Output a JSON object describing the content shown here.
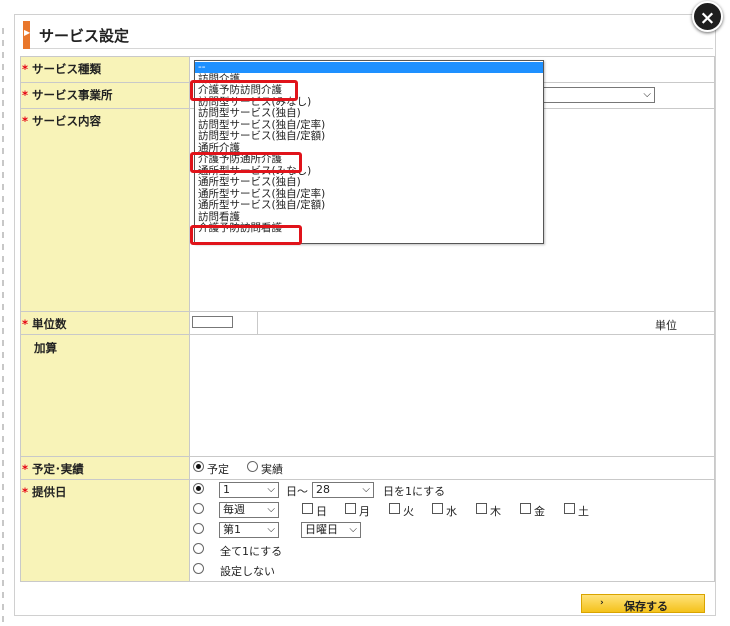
{
  "dialog": {
    "title": "サービス設定",
    "close_label": "×"
  },
  "labels": {
    "service_type": "サービス種類",
    "provider": "サービス事業所",
    "content": "サービス内容",
    "units": "単位数",
    "addition": "加算",
    "plan": "予定･実績",
    "days": "提供日",
    "required_mark": "*"
  },
  "service_type_list": {
    "options": [
      "--",
      "訪問介護",
      "介護予防訪問介護",
      "訪問型サービス(みなし)",
      "訪問型サービス(独自)",
      "訪問型サービス(独自/定率)",
      "訪問型サービス(独自/定額)",
      "通所介護",
      "介護予防通所介護",
      "通所型サービス(みなし)",
      "通所型サービス(独自)",
      "通所型サービス(独自/定率)",
      "通所型サービス(独自/定額)",
      "訪問看護",
      "介護予防訪問看護"
    ],
    "selected_index": 0,
    "highlighted": [
      "介護予防訪問介護",
      "介護予防通所介護",
      "介護予防訪問看護"
    ]
  },
  "units": {
    "suffix": "単位",
    "value": ""
  },
  "plan_actual": {
    "options": [
      "予定",
      "実績"
    ],
    "selected": "予定"
  },
  "days": {
    "row1": {
      "from": "1",
      "sep": "日〜",
      "to": "28",
      "suffix": "日を1にする"
    },
    "row2": {
      "freq": "毎週",
      "weekdays": [
        "日",
        "月",
        "火",
        "水",
        "木",
        "金",
        "土"
      ]
    },
    "row3": {
      "week": "第1",
      "weekday": "日曜日"
    },
    "row4": "全て1にする",
    "row5": "設定しない",
    "selected_row": 1
  },
  "save_button": {
    "label": "保存する",
    "chevron": "›"
  },
  "colors": {
    "accent": "#e9772c",
    "label_bg": "#f8f3b8",
    "required": "#e60012",
    "highlight_box": "#e0131a",
    "listbox_selected": "#1e90ff",
    "save_bg": "#f4c21b"
  }
}
